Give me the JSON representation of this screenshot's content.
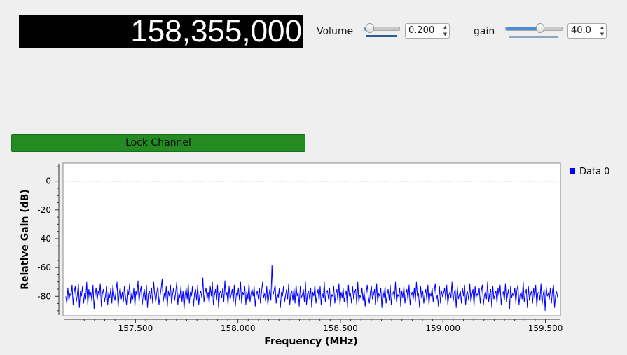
{
  "frequency_display": "158,355,000",
  "volume": {
    "label": "Volume",
    "value": "0.200",
    "fraction": 0.07
  },
  "gain": {
    "label": "gain",
    "value": "40.0",
    "fraction": 0.65
  },
  "lock_button": {
    "label": "Lock Channel"
  },
  "spin_up_glyph": "▲",
  "spin_down_glyph": "▼",
  "colors": {
    "trace": "#0000ff",
    "button": "#248b23",
    "zero_line": "#007878"
  },
  "chart_data": {
    "type": "line",
    "xlabel": "Frequency (MHz)",
    "ylabel": "Relative Gain (dB)",
    "xlim": [
      157.15,
      159.57
    ],
    "ylim": [
      -93,
      12
    ],
    "xticks": [
      157.5,
      158.0,
      158.5,
      159.0,
      159.5
    ],
    "xtick_labels": [
      "157.500",
      "158.000",
      "158.500",
      "159.000",
      "159.500"
    ],
    "yticks": [
      0,
      -20,
      -40,
      -60,
      -80
    ],
    "ytick_labels": [
      "0",
      "-20",
      "-40",
      "-60",
      "-80"
    ],
    "reference_line": {
      "y": 0,
      "style": "dotted"
    },
    "legend": {
      "position": "right",
      "entries": [
        "Data 0"
      ]
    },
    "series": [
      {
        "name": "Data 0",
        "x_start": 157.16,
        "x_end": 159.56,
        "values": [
          -80,
          -85,
          -74,
          -83,
          -78,
          -80,
          -72,
          -86,
          -77,
          -73,
          -84,
          -79,
          -71,
          -88,
          -76,
          -80,
          -73,
          -85,
          -78,
          -82,
          -70,
          -86,
          -75,
          -81,
          -77,
          -84,
          -72,
          -89,
          -79,
          -74,
          -83,
          -76,
          -80,
          -71,
          -87,
          -78,
          -75,
          -84,
          -79,
          -73,
          -86,
          -77,
          -81,
          -74,
          -85,
          -72,
          -79,
          -83,
          -76,
          -70,
          -88,
          -78,
          -74,
          -82,
          -77,
          -84,
          -73,
          -80,
          -86,
          -75,
          -79,
          -71,
          -85,
          -78,
          -82,
          -74,
          -87,
          -76,
          -80,
          -69,
          -84,
          -77,
          -73,
          -86,
          -79,
          -75,
          -83,
          -72,
          -88,
          -78,
          -76,
          -82,
          -74,
          -85,
          -70,
          -79,
          -84,
          -77,
          -73,
          -86,
          -80,
          -75,
          -68,
          -84,
          -78,
          -82,
          -73,
          -87,
          -76,
          -80,
          -72,
          -85,
          -79,
          -74,
          -83,
          -77,
          -70,
          -86,
          -78,
          -81,
          -73,
          -84,
          -76,
          -89,
          -79,
          -74,
          -82,
          -71,
          -85,
          -77,
          -80,
          -73,
          -87,
          -78,
          -75,
          -83,
          -72,
          -86,
          -79,
          -76,
          -81,
          -67,
          -84,
          -78,
          -74,
          -82,
          -77,
          -85,
          -73,
          -80,
          -70,
          -86,
          -79,
          -75,
          -83,
          -72,
          -88,
          -78,
          -76,
          -81,
          -74,
          -84,
          -69,
          -80,
          -77,
          -86,
          -73,
          -82,
          -79,
          -75,
          -84,
          -72,
          -87,
          -78,
          -80,
          -74,
          -83,
          -70,
          -85,
          -77,
          -79,
          -73,
          -86,
          -76,
          -82,
          -71,
          -84,
          -78,
          -75,
          -80,
          -73,
          -87,
          -79,
          -76,
          -82,
          -74,
          -85,
          -77,
          -70,
          -81,
          -78,
          -84,
          -73,
          -86,
          -80,
          -75,
          -83,
          -58,
          -79,
          -76,
          -72,
          -85,
          -78,
          -81,
          -74,
          -88,
          -77,
          -80,
          -73,
          -84,
          -79,
          -75,
          -82,
          -71,
          -86,
          -78,
          -76,
          -83,
          -74,
          -85,
          -72,
          -80,
          -77,
          -87,
          -73,
          -81,
          -79,
          -75,
          -84,
          -70,
          -86,
          -78,
          -76,
          -82,
          -74,
          -88,
          -77,
          -80,
          -72,
          -85,
          -79,
          -75,
          -83,
          -73,
          -86,
          -78,
          -81,
          -70,
          -84,
          -77,
          -76,
          -82,
          -74,
          -87,
          -79,
          -80,
          -73,
          -85,
          -78,
          -75,
          -83,
          -71,
          -86,
          -77,
          -81,
          -74,
          -84,
          -79,
          -76,
          -88,
          -72,
          -80,
          -78,
          -85,
          -73,
          -82,
          -77,
          -75,
          -86,
          -70,
          -84,
          -79,
          -81,
          -74,
          -83,
          -76,
          -87,
          -78,
          -72,
          -80,
          -85,
          -77,
          -73,
          -82,
          -79,
          -75,
          -86,
          -71,
          -84,
          -78,
          -80,
          -74,
          -88,
          -76,
          -81,
          -73,
          -85,
          -79,
          -75,
          -83,
          -72,
          -86,
          -78,
          -77,
          -82,
          -70,
          -84,
          -79,
          -80,
          -74,
          -87,
          -76,
          -81,
          -73,
          -85,
          -78,
          -75,
          -83,
          -72,
          -86,
          -79,
          -77,
          -82,
          -74,
          -84,
          -70,
          -80,
          -78,
          -88,
          -73,
          -81,
          -76,
          -85,
          -79,
          -75,
          -83,
          -72,
          -86,
          -78,
          -80,
          -74,
          -84,
          -77,
          -71,
          -82,
          -79,
          -87,
          -73,
          -85,
          -76,
          -80,
          -78,
          -74,
          -83,
          -72,
          -86,
          -79,
          -77,
          -81,
          -70,
          -84,
          -78,
          -75,
          -88,
          -73,
          -82,
          -79,
          -76,
          -85,
          -74,
          -80,
          -72,
          -86,
          -78,
          -77,
          -83,
          -71,
          -84,
          -79,
          -75,
          -87,
          -73,
          -81,
          -78,
          -80,
          -74,
          -85,
          -76,
          -72,
          -86,
          -79,
          -77,
          -82,
          -70,
          -84,
          -78,
          -75,
          -88,
          -73,
          -82,
          -79,
          -76,
          -85,
          -74,
          -80,
          -72,
          -86,
          -78,
          -77,
          -83,
          -71,
          -84,
          -79,
          -75,
          -89,
          -73,
          -81,
          -78,
          -80,
          -74,
          -85,
          -76,
          -72,
          -86,
          -79,
          -77,
          -82,
          -70,
          -84,
          -78,
          -75,
          -88,
          -73,
          -83,
          -79,
          -76,
          -85,
          -74,
          -81,
          -72,
          -87,
          -78,
          -77,
          -83,
          -71,
          -86,
          -79,
          -75,
          -90,
          -73,
          -80,
          -78,
          -82,
          -74,
          -85,
          -76,
          -72,
          -88,
          -79,
          -77,
          -81
        ]
      }
    ]
  }
}
